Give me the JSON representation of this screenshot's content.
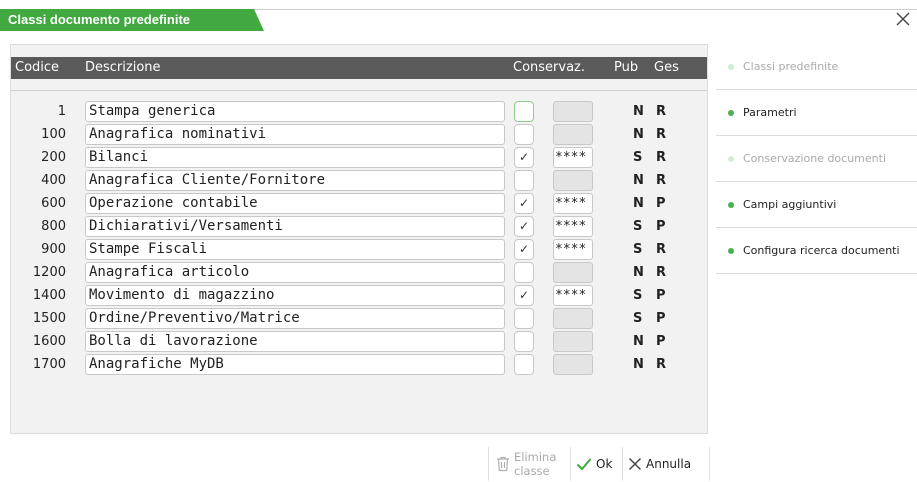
{
  "window": {
    "title": "Classi documento predefinite",
    "close_icon": "close-icon"
  },
  "colors": {
    "accent": "#41a940",
    "header_bg": "#5a5a5a",
    "panel_bg": "#f2f2f2"
  },
  "table": {
    "headers": {
      "codice": "Codice",
      "descrizione": "Descrizione",
      "conservaz": "Conservaz.",
      "pub": "Pub",
      "ges": "Ges"
    },
    "rows": [
      {
        "codice": "1",
        "descrizione": "Stampa generica",
        "checked": false,
        "cons": "",
        "pub": "N",
        "ges": "R"
      },
      {
        "codice": "100",
        "descrizione": "Anagrafica nominativi",
        "checked": false,
        "cons": "",
        "pub": "N",
        "ges": "R"
      },
      {
        "codice": "200",
        "descrizione": "Bilanci",
        "checked": true,
        "cons": "****",
        "pub": "S",
        "ges": "R"
      },
      {
        "codice": "400",
        "descrizione": "Anagrafica Cliente/Fornitore",
        "checked": false,
        "cons": "",
        "pub": "N",
        "ges": "R"
      },
      {
        "codice": "600",
        "descrizione": "Operazione contabile",
        "checked": true,
        "cons": "****",
        "pub": "N",
        "ges": "P"
      },
      {
        "codice": "800",
        "descrizione": "Dichiarativi/Versamenti",
        "checked": true,
        "cons": "****",
        "pub": "S",
        "ges": "P"
      },
      {
        "codice": "900",
        "descrizione": "Stampe Fiscali",
        "checked": true,
        "cons": "****",
        "pub": "S",
        "ges": "R"
      },
      {
        "codice": "1200",
        "descrizione": "Anagrafica articolo",
        "checked": false,
        "cons": "",
        "pub": "N",
        "ges": "R"
      },
      {
        "codice": "1400",
        "descrizione": "Movimento di magazzino",
        "checked": true,
        "cons": "****",
        "pub": "S",
        "ges": "P"
      },
      {
        "codice": "1500",
        "descrizione": "Ordine/Preventivo/Matrice",
        "checked": false,
        "cons": "",
        "pub": "S",
        "ges": "P"
      },
      {
        "codice": "1600",
        "descrizione": "Bolla di lavorazione",
        "checked": false,
        "cons": "",
        "pub": "N",
        "ges": "P"
      },
      {
        "codice": "1700",
        "descrizione": "Anagrafiche MyDB",
        "checked": false,
        "cons": "",
        "pub": "N",
        "ges": "R"
      }
    ]
  },
  "sidebar": {
    "items": [
      {
        "label": "Classi predefinite",
        "enabled": false
      },
      {
        "label": "Parametri",
        "enabled": true
      },
      {
        "label": "Conservazione documenti",
        "enabled": false
      },
      {
        "label": "Campi aggiuntivi",
        "enabled": true
      },
      {
        "label": "Configura ricerca documenti",
        "enabled": true
      }
    ]
  },
  "buttons": {
    "elimina_line1": "Elimina",
    "elimina_line2": "classe",
    "ok": "Ok",
    "annulla": "Annulla"
  },
  "check_glyph": "✓"
}
